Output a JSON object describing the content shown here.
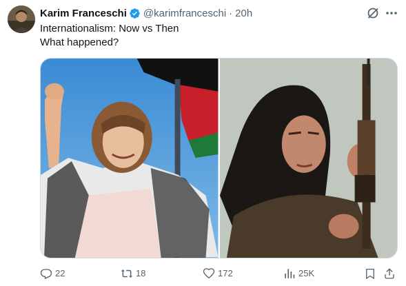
{
  "tweet": {
    "author_name": "Karim Franceschi",
    "author_handle": "@karimfranceschi",
    "separator": "·",
    "time": "20h",
    "text_lines": [
      "Internationalism: Now vs Then",
      "What happened?"
    ],
    "verified": true
  },
  "media": {
    "left_image": "woman-with-keffiyeh-raised-fist-flag",
    "right_image": "woman-holding-rifle"
  },
  "actions": {
    "replies": "22",
    "reposts": "18",
    "likes": "172",
    "views": "25K"
  },
  "icons": {
    "verified": "verified-badge-icon",
    "grok": "grok-icon",
    "more": "more-icon",
    "reply": "reply-icon",
    "repost": "repost-icon",
    "like": "like-icon",
    "views": "views-icon",
    "bookmark": "bookmark-icon",
    "share": "share-icon"
  },
  "colors": {
    "accent": "#1d9bf0",
    "muted": "#536471",
    "text": "#0f1419"
  }
}
